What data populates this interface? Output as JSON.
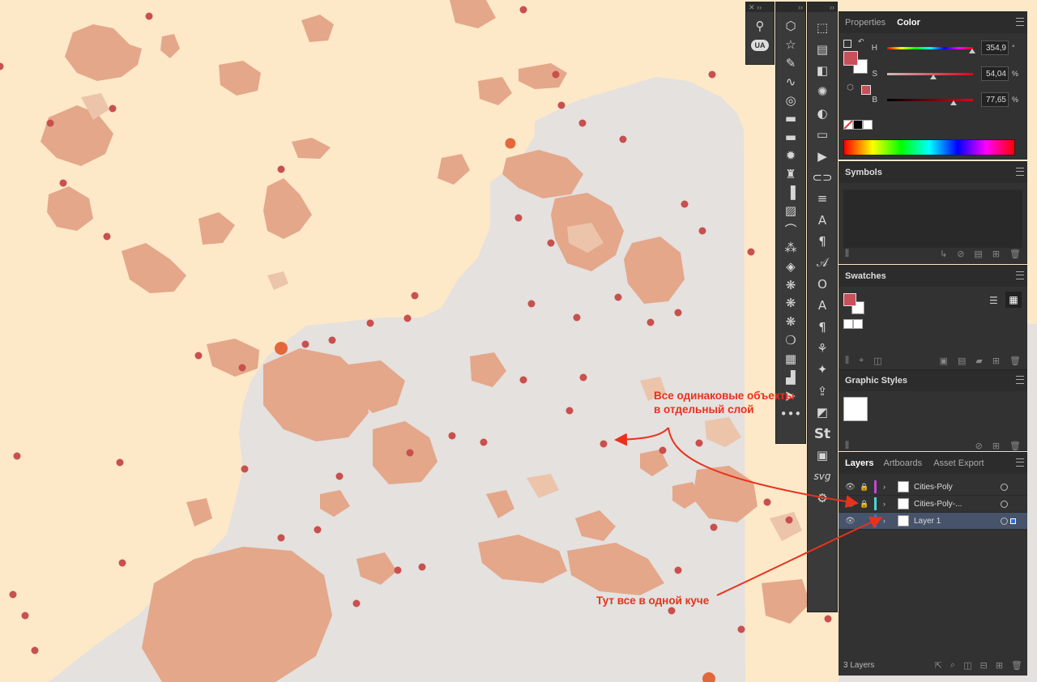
{
  "colors": {
    "land_bg": "#fde8c8",
    "gray_zone": "#e4e1df",
    "city_fill": "#e4a78a",
    "city_light": "#ecc4aa",
    "dot_fill": "#c8504d",
    "dot_orange": "#e2683c",
    "panel_bg": "#323232",
    "annot_red": "#e8321c",
    "selected_color": "#c8505a"
  },
  "tools_left": {
    "label_ua": "UA",
    "icons": [
      "puppet-warp-icon",
      "user-badge-icon"
    ]
  },
  "tools_col2": {
    "icons": [
      "polygon-icon",
      "star-icon",
      "pencil-icon",
      "curvature-icon",
      "spiral-icon",
      "flag-icon",
      "flag-alt-icon",
      "starburst-icon",
      "crown-icon",
      "bar-chart-icon",
      "image-trace-icon",
      "brush-icon",
      "magic-wand-icon",
      "symbol-sprayer-icon",
      "symbol-shifter-icon",
      "symbol-scruncher-icon",
      "symbol-sizer-icon",
      "symbol-spinner-icon",
      "mesh-icon",
      "graph-icon",
      "direct-select-plus-icon",
      "more-icon"
    ],
    "glyphs": [
      "⬡",
      "☆",
      "✎",
      "∿",
      "◎",
      "▬",
      "▬",
      "✹",
      "♜",
      "▐",
      "▨",
      "⌒",
      "⁂",
      "◈",
      "❋",
      "❋",
      "❋",
      "❍",
      "▦",
      "▟",
      "▶",
      "•••"
    ]
  },
  "tools_col3": {
    "icons": [
      "transform-icon",
      "align-icon",
      "pathfinder-icon",
      "appearance-icon",
      "transparency-icon",
      "gradient-icon",
      "actions-icon",
      "links-icon",
      "stroke-icon",
      "character-icon",
      "paragraph-icon",
      "glyphs-icon",
      "opentype-icon",
      "char-styles-icon",
      "para-styles-icon",
      "puppet-icon",
      "magic-icon",
      "export-icon",
      "libraries-icon",
      "stock-icon",
      "image-icon",
      "svg-icon",
      "gear-icon"
    ],
    "glyphs": [
      "⬚",
      "▤",
      "◧",
      "✺",
      "◐",
      "▭",
      "▶",
      "⊂⊃",
      "≡",
      "A",
      "¶",
      "𝒜",
      "O",
      "A",
      "¶",
      "⚘",
      "✦",
      "⇪",
      "◩",
      "St",
      "▣",
      "svg",
      "⚙"
    ]
  },
  "color_panel": {
    "tabs": [
      "Properties",
      "Color"
    ],
    "active_tab": "Color",
    "sliders": [
      {
        "label": "H",
        "value": "354,9",
        "unit": "°",
        "position": 0.986
      },
      {
        "label": "S",
        "value": "54,04",
        "unit": "%",
        "position": 0.5404
      },
      {
        "label": "B",
        "value": "77,65",
        "unit": "%",
        "position": 0.7765
      }
    ]
  },
  "symbols_panel": {
    "title": "Symbols"
  },
  "swatches_panel": {
    "title": "Swatches"
  },
  "graphic_styles_panel": {
    "title": "Graphic Styles"
  },
  "layers_panel": {
    "tabs": [
      "Layers",
      "Artboards",
      "Asset Export"
    ],
    "active_tab": "Layers",
    "layers": [
      {
        "name": "Cities-Poly",
        "color": "#c04ad0",
        "selected": false
      },
      {
        "name": "Cities-Poly-...",
        "color": "#4ad6d6",
        "selected": false
      },
      {
        "name": "Layer 1",
        "color": "#3d6ee8",
        "selected": true
      }
    ],
    "count_label": "3 Layers"
  },
  "annotations": {
    "top_line1": "Все одинаковые объекты",
    "top_line2": "в отдельный слой",
    "bottom": "Тут все в одной куче"
  }
}
